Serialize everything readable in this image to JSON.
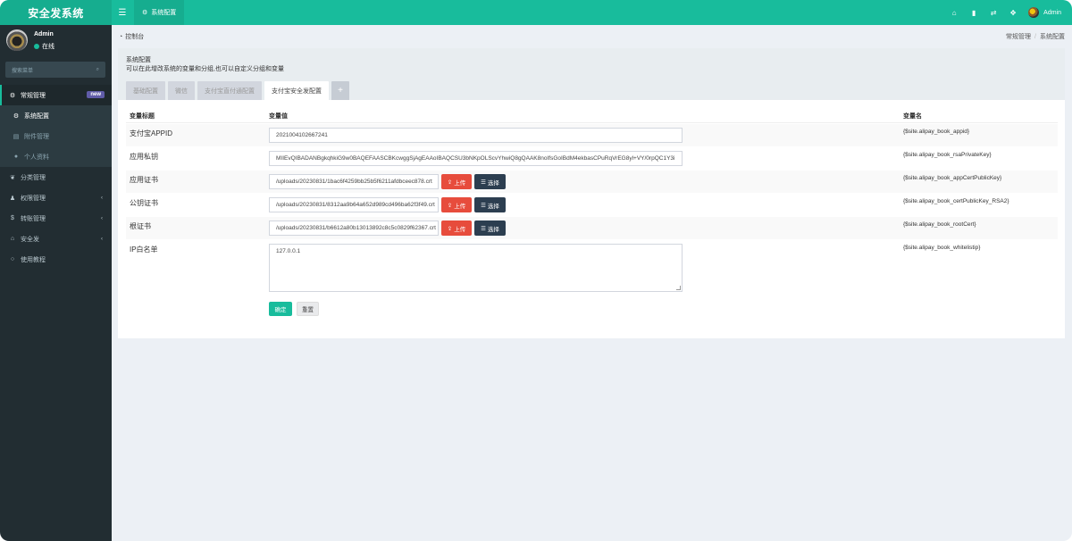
{
  "app": {
    "title": "安全发系统"
  },
  "topbar": {
    "tab_label": "系统配置",
    "user_name": "Admin"
  },
  "sidebar": {
    "user": {
      "name": "Admin",
      "status": "在线"
    },
    "search_placeholder": "搜索菜单",
    "items": [
      {
        "label": "常规管理",
        "badge": "new"
      },
      {
        "label": "系统配置"
      },
      {
        "label": "附件管理"
      },
      {
        "label": "个人资料"
      },
      {
        "label": "分类管理"
      },
      {
        "label": "权限管理"
      },
      {
        "label": "转账管理"
      },
      {
        "label": "安全发"
      },
      {
        "label": "使用教程"
      }
    ]
  },
  "breadcrumb": {
    "left": "控制台",
    "right": [
      "常规管理",
      "系统配置"
    ]
  },
  "panel": {
    "title": "系统配置",
    "description": "可以在此增改系统的变量和分组,也可以自定义分组和变量",
    "tabs": [
      "基础配置",
      "微信",
      "支付宝直付通配置",
      "支付宝安全发配置"
    ]
  },
  "table": {
    "headers": [
      "变量标题",
      "变量值",
      "变量名"
    ],
    "rows": [
      {
        "title": "支付宝APPID",
        "value": "2021004102667241",
        "name": "{$site.alipay_book_appid}"
      },
      {
        "title": "应用私钥",
        "value": "MIIEvQIBADANBgkqhkiG9w0BAQEFAASCBKcwggSjAgEAAoIBAQCSU3bNKpOLScvYhwiQ8gQAAK8noIfsGoIBdM4ekbasCPuRqVrEG8yl+VY/0rpQC1Y3i",
        "name": "{$site.alipay_book_rsaPrivateKey}"
      },
      {
        "title": "应用证书",
        "value": "/uploads/20230831/1bac6f4259bb25b5f6211afdbceec878.crt",
        "name": "{$site.alipay_book_appCertPublicKey}"
      },
      {
        "title": "公钥证书",
        "value": "/uploads/20230831/8312aa9b64a652d989cd496ba62f3f49.crt",
        "name": "{$site.alipay_book_certPublicKey_RSA2}"
      },
      {
        "title": "根证书",
        "value": "/uploads/20230831/b6612a80b13013892c8c5c0829f62367.crt",
        "name": "{$site.alipay_book_rootCert}"
      },
      {
        "title": "IP白名单",
        "value": "127.0.0.1",
        "name": "{$site.alipay_book_whitelistip}"
      }
    ]
  },
  "buttons": {
    "upload": "上传",
    "select": "选择",
    "submit": "确定",
    "reset": "重置"
  },
  "colors": {
    "primary": "#18bc9c",
    "sidebar_bg": "#222d32",
    "danger": "#e74c3c",
    "dark": "#2c3e50"
  }
}
